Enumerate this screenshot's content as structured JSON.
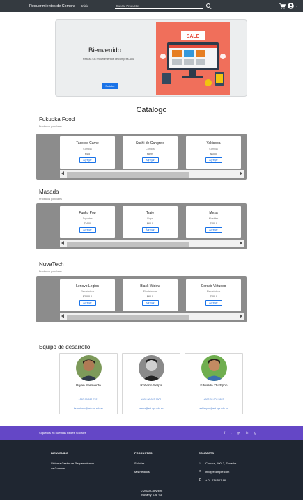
{
  "nav": {
    "brand": "Requerimientos de Compra",
    "home": "Inicio",
    "search_placeholder": "Buscar Productos"
  },
  "hero": {
    "title": "Bienvenido",
    "subtitle": "Realiza tus requerimientos de compras Aquí",
    "button": "Solicitar",
    "image_text": "SALE"
  },
  "catalog": {
    "title": "Catálogo",
    "categories": [
      {
        "name": "Fukuoka Food",
        "subtitle": "Productos populares",
        "products": [
          {
            "name": "Taco de Carne",
            "category": "Comida",
            "price": "$4.5",
            "button": "Agregar"
          },
          {
            "name": "Sushi de Cangrejo",
            "category": "Comida",
            "price": "$8.99",
            "button": "Agregar"
          },
          {
            "name": "Yakisoba",
            "category": "Comida",
            "price": "$10.0",
            "button": "Agregar"
          }
        ]
      },
      {
        "name": "Masada",
        "subtitle": "Productos populares",
        "products": [
          {
            "name": "Funko Pop",
            "category": "Juguetes",
            "price": "$24.00",
            "button": "Agregar"
          },
          {
            "name": "Traje",
            "category": "Ropa",
            "price": "$60.0",
            "button": "Agregar"
          },
          {
            "name": "Mesa",
            "category": "Muebles",
            "price": "$100.0",
            "button": "Agregar"
          }
        ]
      },
      {
        "name": "NuvaTech",
        "subtitle": "Productos populares",
        "products": [
          {
            "name": "Lenovo Legion",
            "category": "Electrónicos",
            "price": "$2000.0",
            "button": "Agregar"
          },
          {
            "name": "Black Widow",
            "category": "Electrónicos",
            "price": "$60.0",
            "button": "Agregar"
          },
          {
            "name": "Corsair Virtuoso",
            "category": "Electrónicos",
            "price": "$300.0",
            "button": "Agregar"
          }
        ]
      }
    ]
  },
  "team": {
    "title": "Equipo de desarrollo",
    "members": [
      {
        "name": "Bryan Sarmiento",
        "phone": "+593 99 681 7211",
        "email": "bsarmiento@est.ups.edu.ec"
      },
      {
        "name": "Roberto Serpa",
        "phone": "+593 99 683 1501",
        "email": "rserpa@est.ups.edu.ec"
      },
      {
        "name": "Eduardo Zhizhpon",
        "phone": "+593 93 903 5883",
        "email": "ezhizhpon@est.ups.edu.ec"
      }
    ]
  },
  "social": {
    "text": "Síguenos en nuestras Redes Sociales",
    "icons": [
      "f",
      "t",
      "g+",
      "in",
      "ig"
    ]
  },
  "footer": {
    "col1_title": "BIENVENIDO",
    "col1_text_1": "Sistema Gestor de Requerimientos",
    "col1_text_2": "de Compra",
    "col2_title": "PRODUCTOS",
    "col2_link1": "Solicitar",
    "col2_link2": "Mis Pedidos",
    "col3_title": "CONTACTO",
    "address": "Cuenca, 10012, Ecuador",
    "email": "info@example.com",
    "phone": "+ 01 234 567 88",
    "copyright_1": "© 2020 Copyright",
    "copyright_2": "Nuvamy S.A. <3"
  },
  "colors": {
    "navbar": "#343a40",
    "accent": "#1a73e8",
    "social_bar": "#6447c6",
    "footer": "#1f2631",
    "carousel": "#8c8c8c"
  }
}
